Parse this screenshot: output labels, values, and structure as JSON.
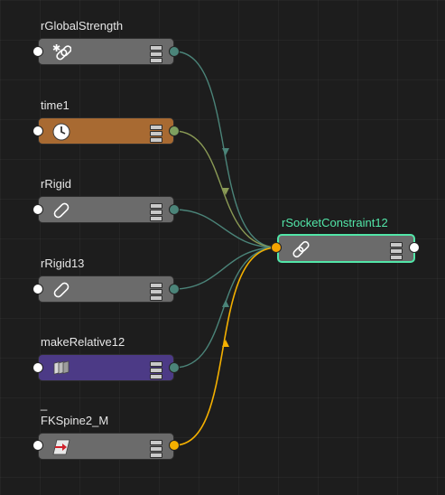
{
  "nodes": [
    {
      "id": "rGlobalStrength",
      "label": "rGlobalStrength",
      "icon": "global-strength-link-icon",
      "color": "#6b6b6b"
    },
    {
      "id": "time1",
      "label": "time1",
      "icon": "clock-icon",
      "color": "#a86a32"
    },
    {
      "id": "rRigid",
      "label": "rRigid",
      "icon": "pill-icon",
      "color": "#6b6b6b"
    },
    {
      "id": "rRigid13",
      "label": "rRigid13",
      "icon": "pill-icon",
      "color": "#6b6b6b"
    },
    {
      "id": "makeRelative12",
      "label": "makeRelative12",
      "icon": "stack-icon",
      "color": "#4c3a86"
    },
    {
      "id": "FKSpine2_M",
      "label_prefix": "_",
      "label": "FKSpine2_M",
      "icon": "joint-arrow-icon",
      "color": "#6b6b6b"
    }
  ],
  "target": {
    "id": "rSocketConstraint12",
    "label": "rSocketConstraint12",
    "icon": "chain-link-icon",
    "highlight": "#52e6a8"
  },
  "connection_colors": {
    "teal": "#4b8479",
    "olive": "#8a9a55",
    "orange": "#f4b000"
  }
}
